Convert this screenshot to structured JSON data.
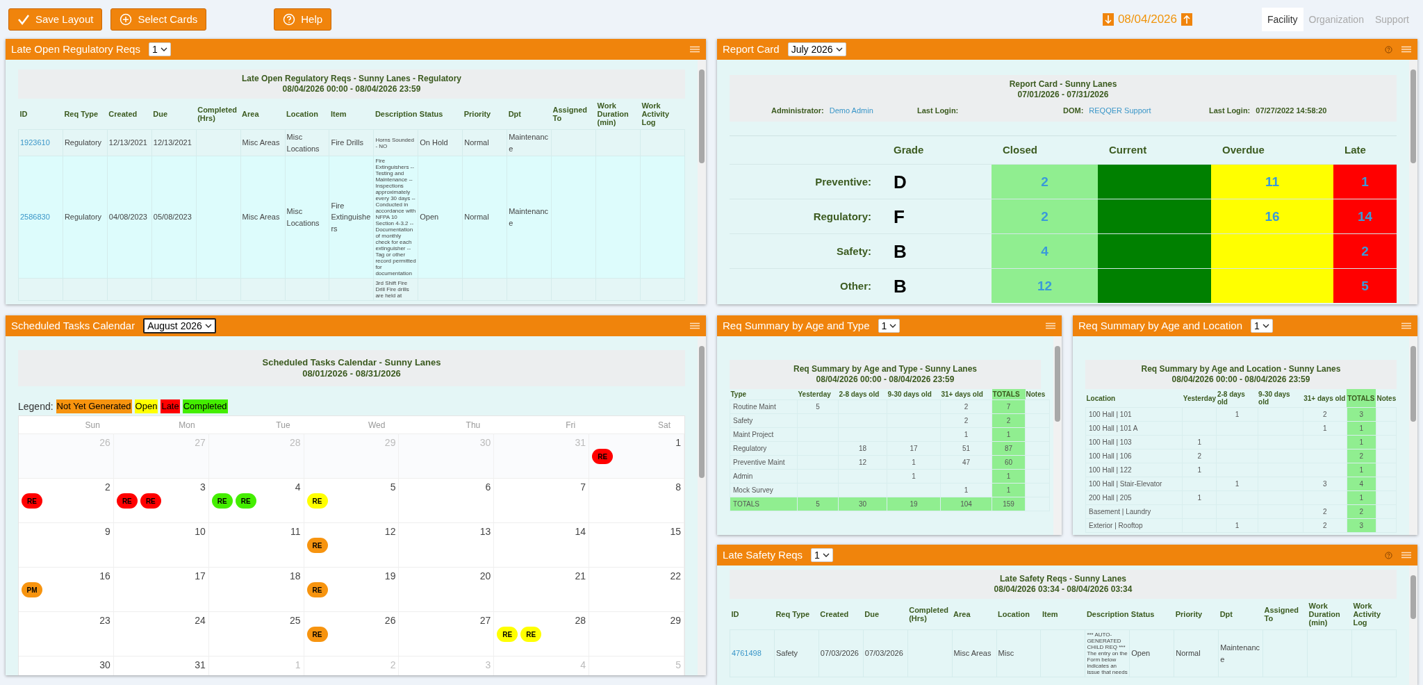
{
  "toolbar": {
    "actions": [
      {
        "label": "Save Layout"
      },
      {
        "label": "Select Cards"
      }
    ],
    "help_button": {
      "label": "Help"
    },
    "date_nav": {
      "date": "08/04/2026"
    },
    "tabs": [
      {
        "label": "Facility",
        "selected": true
      },
      {
        "label": "Organization",
        "selected": false
      },
      {
        "label": "Support",
        "selected": false
      }
    ]
  },
  "late_regulatory": {
    "title": "Late Open Regulatory Reqs",
    "select": {
      "value": "1",
      "focused": false
    },
    "help": false,
    "report_title": "Late Open Regulatory Reqs - Sunny Lanes - Regulatory",
    "report_range": "08/04/2026 00:00 - 08/04/2026 23:59",
    "columns": [
      "ID",
      "Req Type",
      "Created",
      "Due",
      "Completed (Hrs)",
      "Area",
      "Location",
      "Item",
      "Description",
      "Status",
      "Priority",
      "Dpt",
      "Assigned To",
      "Work Duration (min)",
      "Work Activity Log"
    ],
    "rows": [
      [
        "1923610",
        "Regulatory",
        "12/13/2021",
        "12/13/2021",
        null,
        "Misc Areas",
        "Misc Locations",
        "Fire Drills",
        "Horns Sounded - NO",
        "On Hold",
        "Normal",
        "Maintenance",
        null,
        null,
        null
      ],
      [
        "2586830",
        "Regulatory",
        "04/08/2023",
        "05/08/2023",
        null,
        "Misc Areas",
        "Misc Locations",
        "Fire Extinguishers",
        "Fire Extinguishers -- Testing and Maintenance -- Inspections approximately every 30 days -- Conducted in accordance with NFPA 10 Section 4-3.2 -- Documentation of monthly check for each extinguisher -- Tag or other record permitted for documentation",
        "Open",
        "Normal",
        "Maintenance",
        null,
        null,
        null
      ],
      [
        null,
        null,
        null,
        null,
        null,
        null,
        null,
        null,
        "3rd Shift Fire Drill Fire drills are held at",
        null,
        null,
        null,
        null,
        null,
        null
      ]
    ]
  },
  "report_card": {
    "title": "Report Card",
    "select": {
      "value": "July 2026",
      "focused": false
    },
    "help": true,
    "report_title": "Report Card - Sunny Lanes",
    "report_range": "07/01/2026 - 07/31/2026",
    "info": [
      {
        "label": "Administrator:",
        "value": "Demo Admin",
        "link": true
      },
      {
        "label": "Last Login:"
      },
      {
        "label": "DOM:",
        "value": "REQQER Support",
        "link": true
      },
      {
        "label": "Last Login:",
        "value": "07/27/2022 14:58:20",
        "link": false
      }
    ],
    "columns": [
      {
        "label": "Grade"
      },
      {
        "label": "Closed",
        "color": "#90ee90"
      },
      {
        "label": "Current",
        "color": "#008000"
      },
      {
        "label": "Overdue",
        "color": "#ffff00"
      },
      {
        "label": "Late",
        "color": "#ff0000"
      }
    ],
    "rows": [
      {
        "label": "Preventive:",
        "grade": "D",
        "closed": "2",
        "overdue": "11",
        "late": "1"
      },
      {
        "label": "Regulatory:",
        "grade": "F",
        "closed": "2",
        "overdue": "16",
        "late": "14"
      },
      {
        "label": "Safety:",
        "grade": "B",
        "closed": "4",
        "late": "2"
      },
      {
        "label": "Other:",
        "grade": "B",
        "closed": "12",
        "late": "5"
      }
    ]
  },
  "calendar": {
    "title": "Scheduled Tasks Calendar",
    "select": {
      "value": "August 2026",
      "focused": true
    },
    "help": false,
    "report_title": "Scheduled Tasks Calendar - Sunny Lanes",
    "report_range": "08/01/2026 - 08/31/2026",
    "legend_label": "Legend:",
    "legend": [
      {
        "label": "Not Yet Generated",
        "color": "#f7940f"
      },
      {
        "label": "Open",
        "color": "#ffff00"
      },
      {
        "label": "Late",
        "color": "#ff0000"
      },
      {
        "label": "Completed",
        "color": "#44ee00"
      }
    ],
    "weekdays": [
      "Sun",
      "Mon",
      "Tue",
      "Wed",
      "Thu",
      "Fri",
      "Sat"
    ],
    "weeks": [
      {
        "days": [
          {
            "day": "26",
            "other_month": true
          },
          {
            "day": "27",
            "other_month": true
          },
          {
            "day": "28",
            "other_month": true
          },
          {
            "day": "29",
            "other_month": true
          },
          {
            "day": "30",
            "other_month": true
          },
          {
            "day": "31",
            "other_month": true
          },
          {
            "day": "1",
            "other_month": false,
            "events": [
              {
                "label": "RE",
                "color": "#ff0000"
              }
            ]
          }
        ]
      },
      {
        "days": [
          {
            "day": "2",
            "other_month": false,
            "events": [
              {
                "label": "RE",
                "color": "#ff0000"
              }
            ]
          },
          {
            "day": "3",
            "other_month": false,
            "events": [
              {
                "label": "RE",
                "color": "#ff0000"
              },
              {
                "label": "RE",
                "color": "#ff0000"
              }
            ]
          },
          {
            "day": "4",
            "other_month": false,
            "events": [
              {
                "label": "RE",
                "color": "#44ee00"
              },
              {
                "label": "RE",
                "color": "#44ee00"
              }
            ]
          },
          {
            "day": "5",
            "other_month": false,
            "events": [
              {
                "label": "RE",
                "color": "#ffff00"
              }
            ]
          },
          {
            "day": "6",
            "other_month": false
          },
          {
            "day": "7",
            "other_month": false
          },
          {
            "day": "8",
            "other_month": false
          }
        ]
      },
      {
        "days": [
          {
            "day": "9",
            "other_month": false
          },
          {
            "day": "10",
            "other_month": false
          },
          {
            "day": "11",
            "other_month": false
          },
          {
            "day": "12",
            "other_month": false,
            "events": [
              {
                "label": "RE",
                "color": "#f7940f"
              }
            ]
          },
          {
            "day": "13",
            "other_month": false
          },
          {
            "day": "14",
            "other_month": false
          },
          {
            "day": "15",
            "other_month": false
          }
        ]
      },
      {
        "days": [
          {
            "day": "16",
            "other_month": false,
            "events": [
              {
                "label": "PM",
                "color": "#f7940f"
              }
            ]
          },
          {
            "day": "17",
            "other_month": false
          },
          {
            "day": "18",
            "other_month": false
          },
          {
            "day": "19",
            "other_month": false,
            "events": [
              {
                "label": "RE",
                "color": "#f7940f"
              }
            ]
          },
          {
            "day": "20",
            "other_month": false
          },
          {
            "day": "21",
            "other_month": false
          },
          {
            "day": "22",
            "other_month": false
          }
        ]
      },
      {
        "days": [
          {
            "day": "23",
            "other_month": false
          },
          {
            "day": "24",
            "other_month": false
          },
          {
            "day": "25",
            "other_month": false
          },
          {
            "day": "26",
            "other_month": false,
            "events": [
              {
                "label": "RE",
                "color": "#f7940f"
              }
            ]
          },
          {
            "day": "27",
            "other_month": false
          },
          {
            "day": "28",
            "other_month": false,
            "events": [
              {
                "label": "RE",
                "color": "#ffff00"
              },
              {
                "label": "RE",
                "color": "#ffff00"
              }
            ]
          },
          {
            "day": "29",
            "other_month": false
          }
        ]
      },
      {
        "days": [
          {
            "day": "30",
            "other_month": false
          },
          {
            "day": "31",
            "other_month": false
          },
          {
            "day": "1",
            "other_month": true
          },
          {
            "day": "2",
            "other_month": true
          },
          {
            "day": "3",
            "other_month": true
          },
          {
            "day": "4",
            "other_month": true
          },
          {
            "day": "5",
            "other_month": true
          }
        ]
      }
    ]
  },
  "summary_by_type": {
    "title": "Req Summary by Age and Type",
    "select": {
      "value": "1",
      "focused": false
    },
    "help": false,
    "report_title": "Req Summary by Age and Type - Sunny Lanes",
    "report_range": "08/04/2026 00:00 - 08/04/2026 23:59",
    "columns": [
      {
        "label": "Type",
        "highlight": false
      },
      {
        "label": "Yesterday",
        "highlight": false
      },
      {
        "label": "2-8 days old",
        "highlight": false
      },
      {
        "label": "9-30 days old",
        "highlight": false
      },
      {
        "label": "31+ days old",
        "highlight": false
      },
      {
        "label": "TOTALS",
        "highlight": true
      },
      {
        "label": "Notes",
        "highlight": false
      }
    ],
    "rows": [
      {
        "kind": "data",
        "cells": [
          "Routine Maint",
          "5",
          null,
          null,
          "2",
          "7",
          null
        ]
      },
      {
        "kind": "data",
        "cells": [
          "Safety",
          null,
          null,
          null,
          "2",
          "2",
          null
        ]
      },
      {
        "kind": "data",
        "cells": [
          "Maint Project",
          null,
          null,
          null,
          "1",
          "1",
          null
        ]
      },
      {
        "kind": "data",
        "cells": [
          "Regulatory",
          null,
          "18",
          "17",
          "51",
          "87",
          null
        ]
      },
      {
        "kind": "data",
        "cells": [
          "Preventive Maint",
          null,
          "12",
          "1",
          "47",
          "60",
          null
        ]
      },
      {
        "kind": "data",
        "cells": [
          "Admin",
          null,
          null,
          "1",
          null,
          "1",
          null
        ]
      },
      {
        "kind": "data",
        "cells": [
          "Mock Survey",
          null,
          null,
          null,
          "1",
          "1",
          null
        ]
      },
      {
        "kind": "total",
        "cells": [
          "TOTALS",
          "5",
          "30",
          "19",
          "104",
          "159",
          null
        ]
      }
    ]
  },
  "summary_by_location": {
    "title": "Req Summary by Age and Location",
    "select": {
      "value": "1",
      "focused": false
    },
    "help": false,
    "report_title": "Req Summary by Age and Location - Sunny Lanes",
    "report_range": "08/04/2026 00:00 - 08/04/2026 23:59",
    "columns": [
      {
        "label": "Location",
        "highlight": false
      },
      {
        "label": "Yesterday",
        "highlight": false
      },
      {
        "label": "2-8 days old",
        "highlight": false
      },
      {
        "label": "9-30 days old",
        "highlight": false
      },
      {
        "label": "31+ days old",
        "highlight": false
      },
      {
        "label": "TOTALS",
        "highlight": true
      },
      {
        "label": "Notes",
        "highlight": false
      }
    ],
    "rows": [
      {
        "kind": "data",
        "cells": [
          "100 Hall | 101",
          null,
          "1",
          null,
          "2",
          "3",
          null
        ]
      },
      {
        "kind": "data",
        "cells": [
          "100 Hall | 101 A",
          null,
          null,
          null,
          "1",
          "1",
          null
        ]
      },
      {
        "kind": "data",
        "cells": [
          "100 Hall | 103",
          "1",
          null,
          null,
          null,
          "1",
          null
        ]
      },
      {
        "kind": "data",
        "cells": [
          "100 Hall | 106",
          "2",
          null,
          null,
          null,
          "2",
          null
        ]
      },
      {
        "kind": "data",
        "cells": [
          "100 Hall | 122",
          "1",
          null,
          null,
          null,
          "1",
          null
        ]
      },
      {
        "kind": "data",
        "cells": [
          "100 Hall | Stair-Elevator",
          null,
          "1",
          null,
          "3",
          "4",
          null
        ]
      },
      {
        "kind": "data",
        "cells": [
          "200 Hall | 205",
          "1",
          null,
          null,
          null,
          "1",
          null
        ]
      },
      {
        "kind": "data",
        "cells": [
          "Basement | Laundry",
          null,
          null,
          null,
          "2",
          "2",
          null
        ]
      },
      {
        "kind": "data",
        "cells": [
          "Exterior | Rooftop",
          null,
          "1",
          null,
          "2",
          "3",
          null
        ]
      }
    ]
  },
  "late_safety": {
    "title": "Late Safety Reqs",
    "select": {
      "value": "1",
      "focused": false
    },
    "help": true,
    "report_title": "Late Safety Reqs - Sunny Lanes",
    "report_range": "08/04/2026 03:34 - 08/04/2026 03:34",
    "columns": [
      "ID",
      "Req Type",
      "Created",
      "Due",
      "Completed (Hrs)",
      "Area",
      "Location",
      "Item",
      "Description",
      "Status",
      "Priority",
      "Dpt",
      "Assigned To",
      "Work Duration (min)",
      "Work Activity Log"
    ],
    "rows": [
      [
        "4761498",
        "Safety",
        "07/03/2026",
        "07/03/2026",
        null,
        "Misc Areas",
        "Misc",
        null,
        "*** AUTO-GENERATED CHILD REQ *** The entry on the Form below indicates an issue that needs",
        "Open",
        "Normal",
        "Maintenance",
        null,
        null,
        null
      ]
    ]
  }
}
